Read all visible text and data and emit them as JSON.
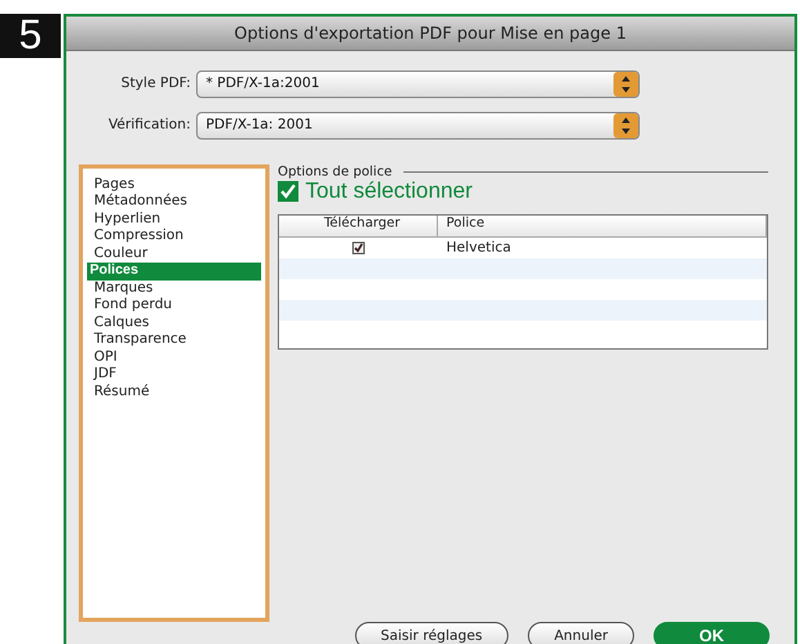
{
  "badge": "5",
  "window": {
    "title": "Options d'exportation PDF pour Mise en page 1"
  },
  "fields": [
    {
      "label": "Style PDF:",
      "value": "* PDF/X-1a:2001"
    },
    {
      "label": "Vérification:",
      "value": "PDF/X-1a: 2001"
    }
  ],
  "sidebar": {
    "items": [
      {
        "label": "Pages",
        "selected": false
      },
      {
        "label": "Métadonnées",
        "selected": false
      },
      {
        "label": "Hyperlien",
        "selected": false
      },
      {
        "label": "Compression",
        "selected": false
      },
      {
        "label": "Couleur",
        "selected": false
      },
      {
        "label": "Polices",
        "selected": true
      },
      {
        "label": "Marques",
        "selected": false
      },
      {
        "label": "Fond perdu",
        "selected": false
      },
      {
        "label": "Calques",
        "selected": false
      },
      {
        "label": "Transparence",
        "selected": false
      },
      {
        "label": "OPI",
        "selected": false
      },
      {
        "label": "JDF",
        "selected": false
      },
      {
        "label": "Résumé",
        "selected": false
      }
    ]
  },
  "section": {
    "title": "Options de police",
    "select_all": {
      "label": "Tout sélectionner",
      "checked": true
    }
  },
  "table": {
    "columns": [
      "Télécharger",
      "Police"
    ],
    "rows": [
      {
        "download": true,
        "font": "Helvetica"
      }
    ]
  },
  "buttons": [
    {
      "label": "Saisir réglages",
      "kind": "normal"
    },
    {
      "label": "Annuler",
      "kind": "normal"
    },
    {
      "label": "OK",
      "kind": "default"
    }
  ]
}
